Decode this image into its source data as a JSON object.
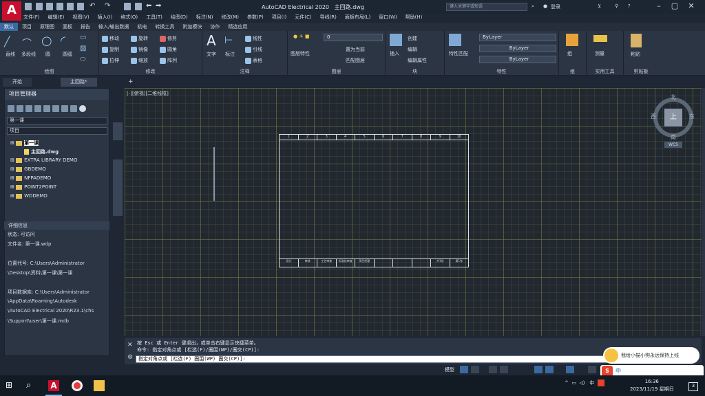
{
  "app": {
    "title": "AutoCAD Electrical 2020",
    "file": "主回路.dwg",
    "search_placeholder": "键入关键字或短语",
    "login": "登录"
  },
  "menu": [
    "文件(F)",
    "编辑(E)",
    "视图(V)",
    "插入(I)",
    "格式(O)",
    "工具(T)",
    "绘图(D)",
    "标注(N)",
    "修改(M)",
    "参数(P)",
    "项目(I)",
    "元件(C)",
    "导线(R)",
    "面板布局(L)",
    "窗口(W)",
    "帮助(H)"
  ],
  "ribbon_tabs": [
    "默认",
    "项目",
    "原理图",
    "面板",
    "报告",
    "输入/输出数据",
    "机电",
    "转换工具",
    "附加模块",
    "协作",
    "精选应用"
  ],
  "ribbon": {
    "draw": {
      "title": "绘图",
      "items": [
        "直线",
        "多段线",
        "圆",
        "圆弧"
      ]
    },
    "modify": {
      "title": "修改",
      "items": [
        "移动",
        "旋转",
        "修剪",
        "复制",
        "镜像",
        "圆角",
        "拉伸",
        "缩放",
        "阵列"
      ]
    },
    "annotation": {
      "title": "注释",
      "items": [
        "文字",
        "标注",
        "线性",
        "引线",
        "表格"
      ]
    },
    "layers": {
      "title": "图层",
      "items": [
        "图层特性",
        "置为当前",
        "匹配图层"
      ],
      "layer_value": "0"
    },
    "block": {
      "title": "块",
      "items": [
        "插入",
        "创建",
        "编辑",
        "编辑属性"
      ]
    },
    "properties": {
      "title": "特性",
      "items": [
        "特性匹配"
      ],
      "color": "ByLayer",
      "linetype": "ByLayer",
      "lineweight": "ByLayer"
    },
    "groups": {
      "title": "组",
      "items": [
        "组"
      ]
    },
    "utilities": {
      "title": "实用工具",
      "items": [
        "测量"
      ]
    },
    "clipboard": {
      "title": "剪贴板",
      "items": [
        "粘贴"
      ]
    }
  },
  "doc_tabs": [
    "开始",
    "主回路*"
  ],
  "project_manager": {
    "title": "项目管理器",
    "project_select": "第一课",
    "view_select": "项目",
    "tree": [
      {
        "label": "第一课",
        "level": 0,
        "type": "folder",
        "active": true
      },
      {
        "label": "主回路.dwg",
        "level": 1,
        "type": "dwg",
        "active": true
      },
      {
        "label": "EXTRA LIBRARY DEMO",
        "level": 0,
        "type": "folder"
      },
      {
        "label": "GBDEMO",
        "level": 0,
        "type": "folder"
      },
      {
        "label": "NFPADEMO",
        "level": 0,
        "type": "folder"
      },
      {
        "label": "POINT2POINT",
        "level": 0,
        "type": "folder"
      },
      {
        "label": "WDDEMO",
        "level": 0,
        "type": "folder"
      }
    ],
    "details_title": "详细信息",
    "details": [
      "状态: 可访问",
      "文件名: 第一课.wdp",
      "",
      "位置代号: C:\\Users\\Administrator",
      "\\Desktop\\资料\\第一课\\第一课",
      "",
      "项目数据库: C:\\Users\\Administrator",
      "\\AppData\\Roaming\\Autodesk",
      "\\AutoCAD Electrical 2020\\R23.1\\chs",
      "\\Support\\user\\第一课.mdb"
    ]
  },
  "side_tabs": [
    "属性",
    "项目管理器"
  ],
  "viewport_label": "[-][俯视][二维线框]",
  "viewcube": {
    "top": "上",
    "north": "北",
    "south": "南",
    "east": "东",
    "west": "西",
    "wcs": "WCS"
  },
  "title_block": {
    "columns": [
      "1",
      "2",
      "3",
      "4",
      "5",
      "6",
      "7",
      "8",
      "9",
      "10"
    ],
    "footer": [
      "设计",
      "审核",
      "工艺审查",
      "标准化审查",
      "项目经理",
      "",
      "",
      "",
      "共1张",
      "第1张"
    ]
  },
  "command": {
    "line1": "按 Esc 或 Enter 键退出，或单击右键显示快捷菜单。",
    "line2": "命令: 指定对角点或 [栏选(F)/圈围(WP)/圈交(CP)]:",
    "input": "指定对角点或 [栏选(F) 圈围(WP) 圈交(CP)]:"
  },
  "status": {
    "model": "模型"
  },
  "notify": "我给小猫小狗永远保持上线",
  "ime": "中",
  "tray": {
    "lang": "中",
    "time": "16:36",
    "date": "2023/11/19 星期日",
    "badge": "3"
  }
}
